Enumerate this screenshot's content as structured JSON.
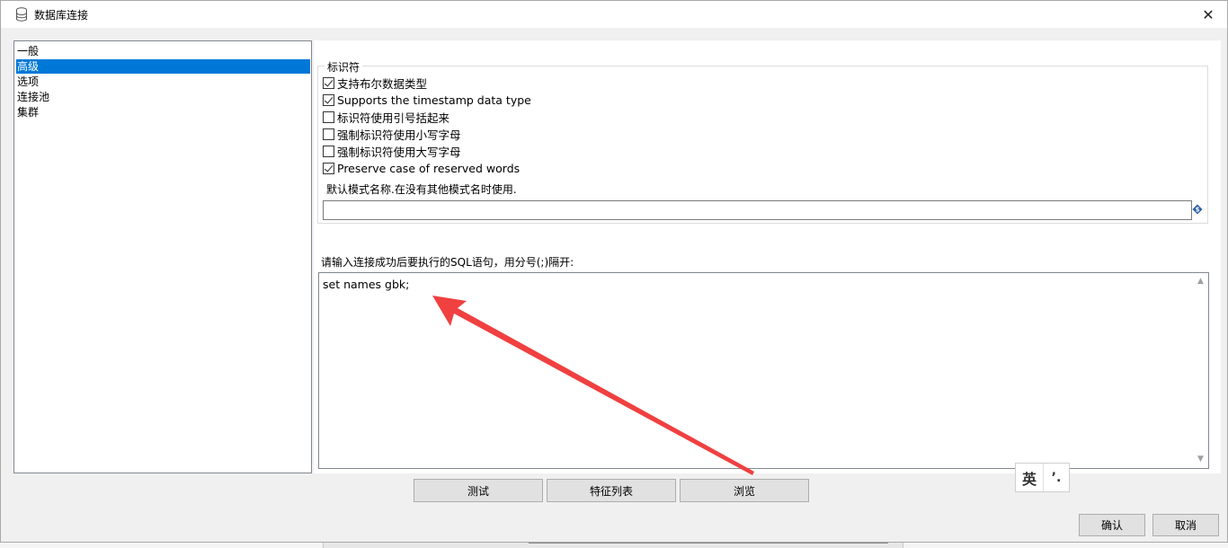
{
  "window": {
    "title": "数据库连接",
    "close_glyph": "✕"
  },
  "nav": {
    "items": [
      {
        "label": "一般",
        "selected": false
      },
      {
        "label": "高级",
        "selected": true
      },
      {
        "label": "选项",
        "selected": false
      },
      {
        "label": "连接池",
        "selected": false
      },
      {
        "label": "集群",
        "selected": false
      }
    ]
  },
  "identifier_group": {
    "legend": "标识符",
    "options": [
      {
        "label": "支持布尔数据类型",
        "checked": true
      },
      {
        "label": "Supports the timestamp data type",
        "checked": true
      },
      {
        "label": "标识符使用引号括起来",
        "checked": false
      },
      {
        "label": "强制标识符使用小写字母",
        "checked": false
      },
      {
        "label": "强制标识符使用大写字母",
        "checked": false
      },
      {
        "label": "Preserve case of reserved words",
        "checked": true
      }
    ],
    "schema_label": "默认模式名称.在没有其他模式名时使用.",
    "schema_value": ""
  },
  "sql": {
    "label": "请输入连接成功后要执行的SQL语句，用分号(;)隔开:",
    "value": "set names gbk;"
  },
  "buttons": {
    "test": "测试",
    "feature_list": "特征列表",
    "browse": "浏览",
    "ok": "确认",
    "cancel": "取消"
  },
  "ime": {
    "mode": "英",
    "punctuation": "’."
  },
  "colors": {
    "selection": "#0078d7",
    "annotation_arrow": "#f04040"
  },
  "icons": {
    "title": "database-icon",
    "variable": "variable-icon"
  }
}
